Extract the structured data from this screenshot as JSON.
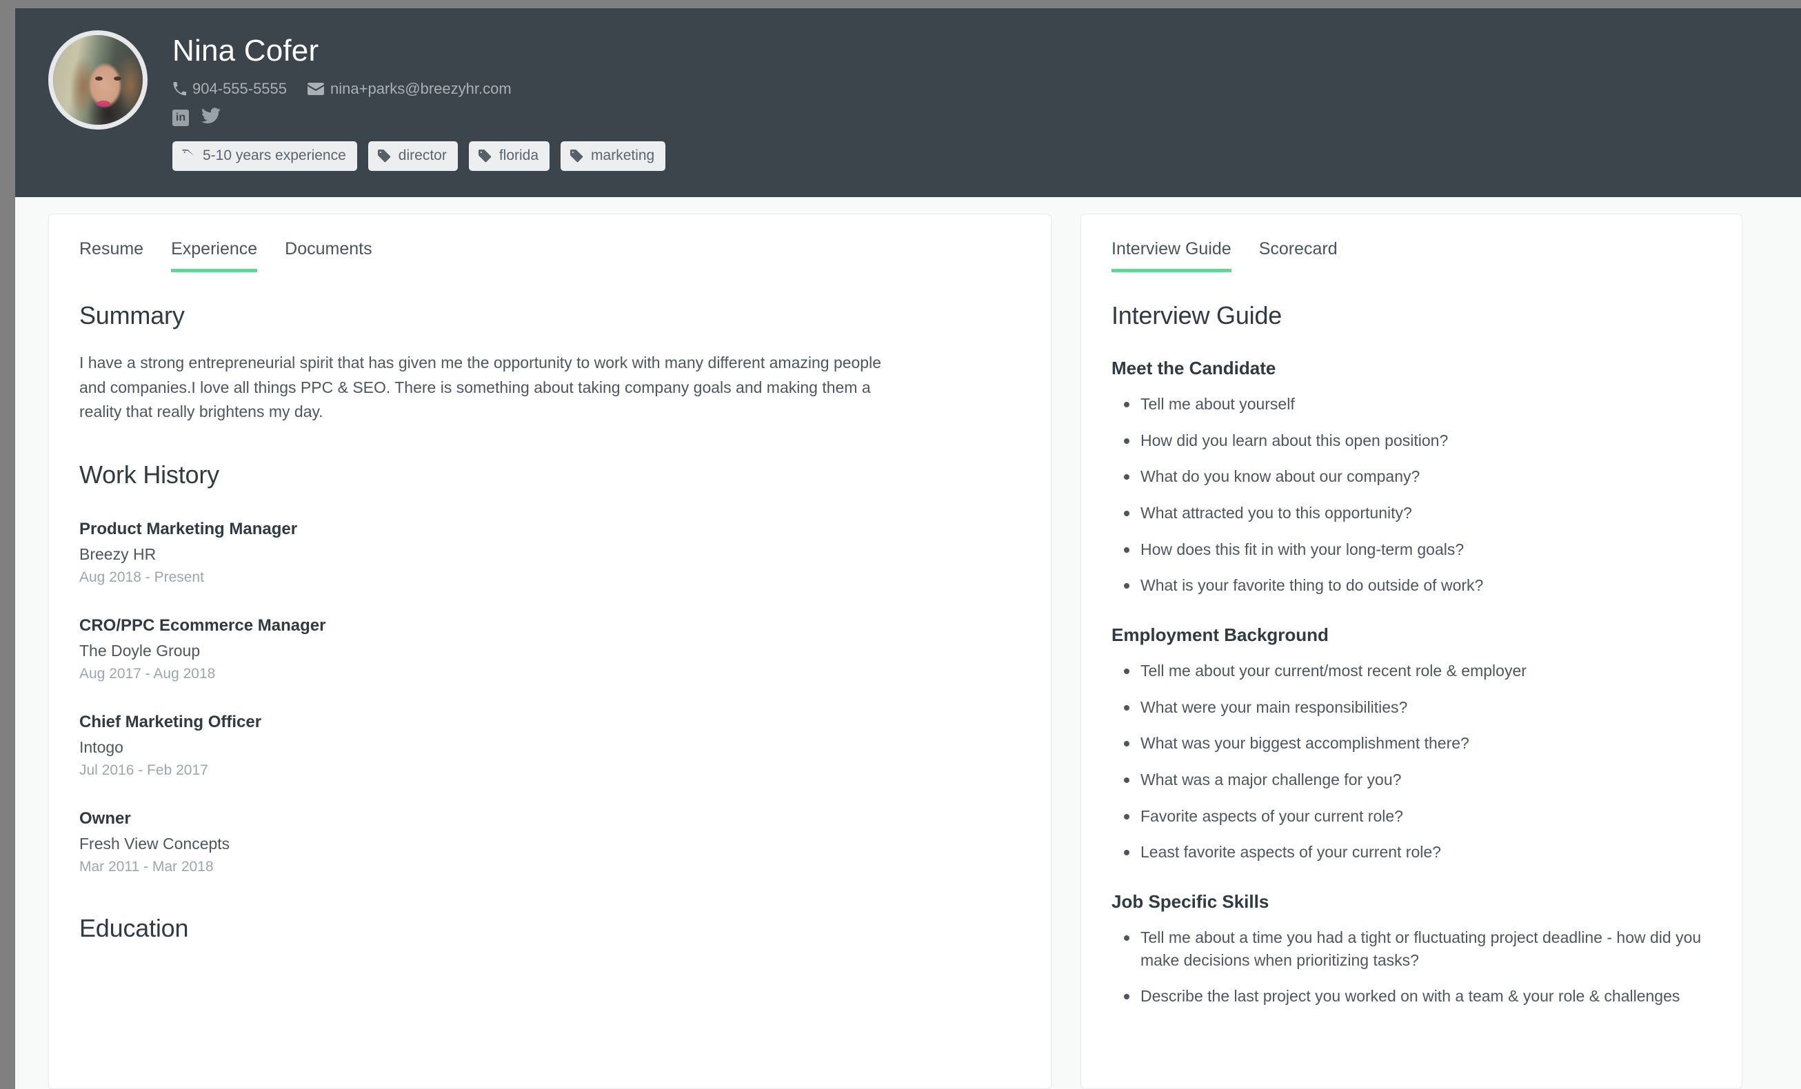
{
  "colors": {
    "header_bg": "#3c454c",
    "page_bg": "#f8f9f9",
    "accent_green": "#6fcf97",
    "tag_chip_bg": "#eceeef",
    "outer_bg": "#808080"
  },
  "header": {
    "name": "Nina Cofer",
    "phone": "904-555-5555",
    "email": "nina+parks@breezyhr.com",
    "phone_icon": "phone-icon",
    "email_icon": "envelope-icon",
    "social": [
      {
        "name": "linkedin-icon",
        "label": "in"
      },
      {
        "name": "twitter-icon",
        "label": ""
      }
    ],
    "tags": [
      "5-10 years experience",
      "director",
      "florida",
      "marketing"
    ]
  },
  "left_panel": {
    "tabs": [
      {
        "label": "Resume",
        "active": false
      },
      {
        "label": "Experience",
        "active": true
      },
      {
        "label": "Documents",
        "active": false
      }
    ],
    "summary": {
      "heading": "Summary",
      "text": "I have a strong entrepreneurial spirit that has given me the opportunity to work with many different amazing people and companies.I love all things PPC & SEO. There is something about taking company goals and making them a reality that really brightens my day."
    },
    "work_history": {
      "heading": "Work History",
      "items": [
        {
          "title": "Product Marketing Manager",
          "company": "Breezy HR",
          "dates": "Aug 2018 - Present"
        },
        {
          "title": "CRO/PPC Ecommerce Manager",
          "company": "The Doyle Group",
          "dates": "Aug 2017 - Aug 2018"
        },
        {
          "title": "Chief Marketing Officer",
          "company": "Intogo",
          "dates": "Jul 2016 - Feb 2017"
        },
        {
          "title": "Owner",
          "company": "Fresh View Concepts",
          "dates": "Mar 2011 - Mar 2018"
        }
      ]
    },
    "education": {
      "heading": "Education"
    }
  },
  "right_panel": {
    "tabs": [
      {
        "label": "Interview Guide",
        "active": true
      },
      {
        "label": "Scorecard",
        "active": false
      }
    ],
    "heading": "Interview Guide",
    "sections": [
      {
        "heading": "Meet the Candidate",
        "questions": [
          "Tell me about yourself",
          "How did you learn about this open position?",
          "What do you know about our company?",
          "What attracted you to this opportunity?",
          "How does this fit in with your long-term goals?",
          "What is your favorite thing to do outside of work?"
        ]
      },
      {
        "heading": "Employment Background",
        "questions": [
          "Tell me about your current/most recent role & employer",
          "What were your main responsibilities?",
          "What was your biggest accomplishment there?",
          "What was a major challenge for you?",
          "Favorite aspects of your current role?",
          "Least favorite aspects of your current role?"
        ]
      },
      {
        "heading": "Job Specific Skills",
        "questions": [
          "Tell me about a time you had a tight or fluctuating project deadline - how did you make decisions when prioritizing tasks?",
          "Describe the last project you worked on with a team & your role & challenges"
        ]
      }
    ]
  }
}
